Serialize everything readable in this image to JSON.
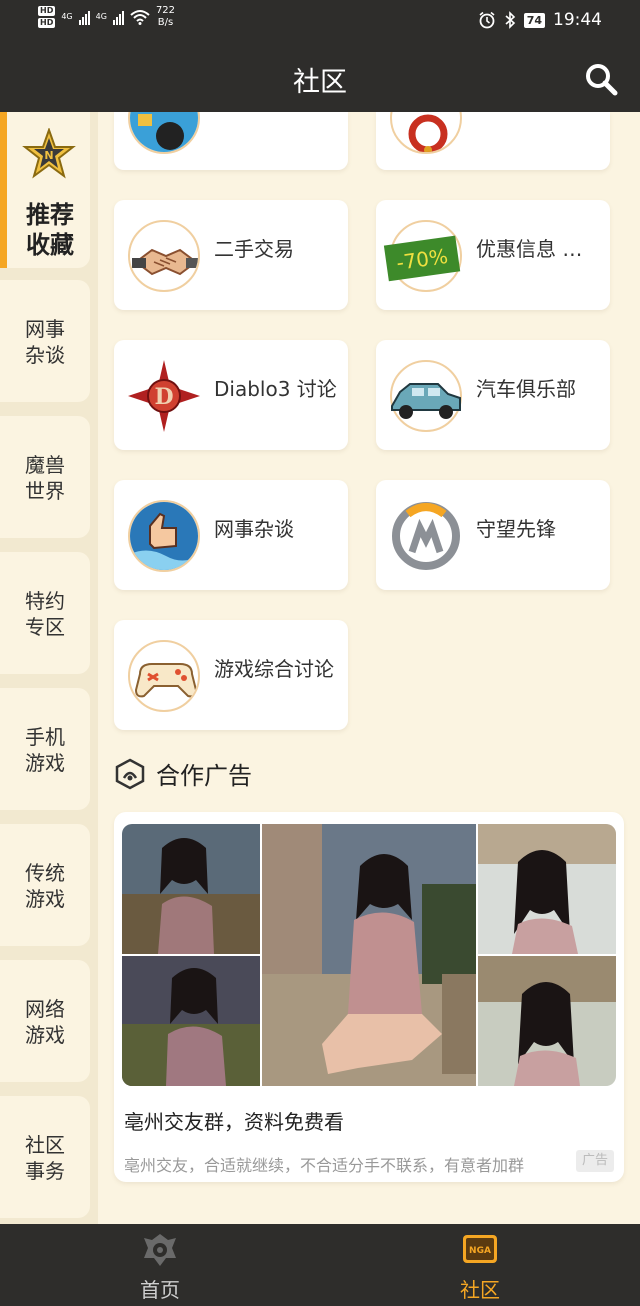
{
  "status_bar": {
    "network_type_1": "4G",
    "network_type_2": "4G",
    "speed_value": "722",
    "speed_unit": "B/s",
    "battery": "74",
    "time": "19:44"
  },
  "header": {
    "title": "社区"
  },
  "sidebar": {
    "active": {
      "line1": "推荐",
      "line2": "收藏"
    },
    "items": [
      {
        "line1": "网事",
        "line2": "杂谈"
      },
      {
        "line1": "魔兽",
        "line2": "世界"
      },
      {
        "line1": "特约",
        "line2": "专区"
      },
      {
        "line1": "手机",
        "line2": "游戏"
      },
      {
        "line1": "传统",
        "line2": "游戏"
      },
      {
        "line1": "网络",
        "line2": "游戏"
      },
      {
        "line1": "社区",
        "line2": "事务"
      }
    ]
  },
  "forums": [
    {
      "name": "二手交易",
      "icon": "handshake-icon"
    },
    {
      "name": "优惠信息 购物",
      "icon": "discount-icon",
      "badge": "-70%"
    },
    {
      "name": "Diablo3 讨论",
      "icon": "diablo-icon",
      "letter": "D"
    },
    {
      "name": "汽车俱乐部",
      "icon": "car-icon"
    },
    {
      "name": "网事杂谈",
      "icon": "thumbs-up-icon"
    },
    {
      "name": "守望先锋",
      "icon": "overwatch-icon"
    },
    {
      "name": "游戏综合讨论",
      "icon": "gamepad-icon"
    }
  ],
  "section": {
    "title": "合作广告"
  },
  "ad": {
    "title": "亳州交友群，资料免费看",
    "description": "亳州交友，合适就继续，不合适分手不联系，有意者加群",
    "badge": "广告"
  },
  "bottom_nav": [
    {
      "label": "首页",
      "icon": "home-emblem-icon",
      "active": false
    },
    {
      "label": "社区",
      "icon": "nga-community-icon",
      "icon_text": "NGA",
      "active": true
    }
  ],
  "colors": {
    "accent": "#f5a623",
    "active_nav": "#f5a623",
    "header_bg": "#2e2d2b",
    "page_bg": "#fbf4e1"
  }
}
